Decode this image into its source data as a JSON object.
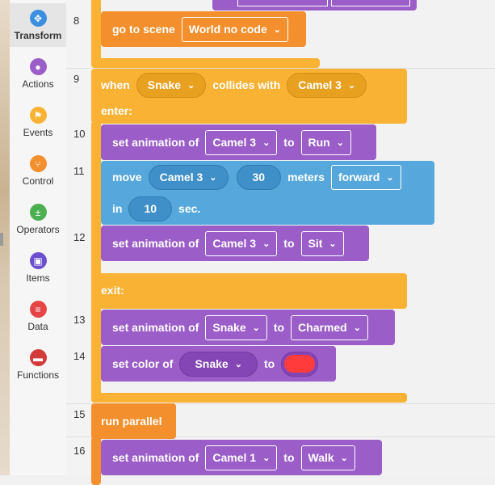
{
  "sidebar": {
    "categories": [
      {
        "label": "Transform",
        "icon": "transform-icon",
        "color": "#3b8fe0",
        "glyph": "✥",
        "active": true
      },
      {
        "label": "Actions",
        "icon": "eye-icon",
        "color": "#9b5dc7",
        "glyph": "●"
      },
      {
        "label": "Events",
        "icon": "flag-icon",
        "color": "#f9b233",
        "glyph": "⚑"
      },
      {
        "label": "Control",
        "icon": "branch-icon",
        "color": "#f38f2c",
        "glyph": "⑂"
      },
      {
        "label": "Operators",
        "icon": "plus-minus-icon",
        "color": "#4caf50",
        "glyph": "±"
      },
      {
        "label": "Items",
        "icon": "cube-icon",
        "color": "#6b4fcf",
        "glyph": "▣"
      },
      {
        "label": "Data",
        "icon": "list-icon",
        "color": "#e64545",
        "glyph": "≡"
      },
      {
        "label": "Functions",
        "icon": "chat-icon",
        "color": "#d33b3b",
        "glyph": "▬"
      }
    ]
  },
  "lines": [
    {
      "n": "8"
    },
    {
      "n": "9"
    },
    {
      "n": "10"
    },
    {
      "n": "11"
    },
    {
      "n": "12"
    },
    {
      "n": "13"
    },
    {
      "n": "14"
    },
    {
      "n": "15"
    },
    {
      "n": "16"
    }
  ],
  "blocks": {
    "go_to_scene": {
      "label": "go to scene",
      "scene": "World no code"
    },
    "collide": {
      "when": "when",
      "a": "Snake",
      "collides": "collides with",
      "b": "Camel 3",
      "enter": "enter:",
      "exit": "exit:"
    },
    "anim1": {
      "label": "set animation of",
      "obj": "Camel 3",
      "to": "to",
      "anim": "Run"
    },
    "move": {
      "label": "move",
      "obj": "Camel 3",
      "dist": "30",
      "unit": "meters",
      "dir": "forward",
      "in": "in",
      "time": "10",
      "sec": "sec."
    },
    "anim2": {
      "label": "set animation of",
      "obj": "Camel 3",
      "to": "to",
      "anim": "Sit"
    },
    "anim3": {
      "label": "set animation of",
      "obj": "Snake",
      "to": "to",
      "anim": "Charmed"
    },
    "color": {
      "label": "set color of",
      "obj": "Snake",
      "to": "to",
      "value": "#ff3b3b"
    },
    "parallel": {
      "label": "run parallel"
    },
    "anim4": {
      "label": "set animation of",
      "obj": "Camel 1",
      "to": "to",
      "anim": "Walk"
    }
  }
}
